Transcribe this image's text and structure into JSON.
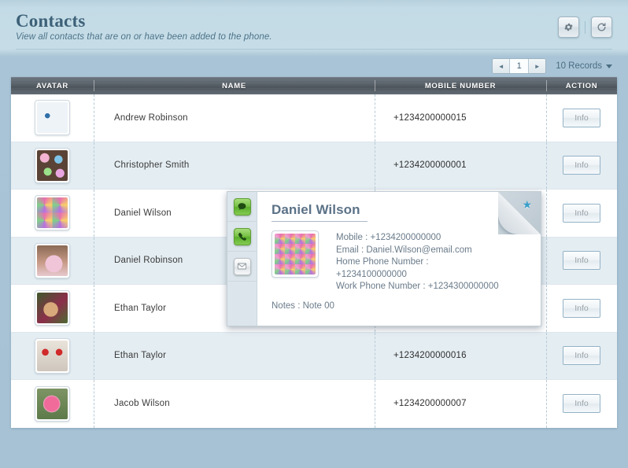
{
  "header": {
    "title": "Contacts",
    "subtitle": "View all contacts that are on or have been added to the phone.",
    "settings_icon": "gear-icon",
    "refresh_icon": "refresh-icon"
  },
  "pager": {
    "prev_label": "◄",
    "page_number": "1",
    "next_label": "►",
    "records_label": "10 Records"
  },
  "table": {
    "columns": [
      "AVATAR",
      "NAME",
      "MOBILE NUMBER",
      "ACTION"
    ],
    "action_label": "Info",
    "rows": [
      {
        "name": "Andrew  Robinson",
        "mobile": "+1234200000015",
        "action": "Info"
      },
      {
        "name": "Christopher  Smith",
        "mobile": "+1234200000001",
        "action": "Info"
      },
      {
        "name": "Daniel  Wilson",
        "mobile": "",
        "action": "Info"
      },
      {
        "name": "Daniel  Robinson",
        "mobile": "",
        "action": "Info"
      },
      {
        "name": "Ethan  Taylor",
        "mobile": "",
        "action": "Info"
      },
      {
        "name": "Ethan  Taylor",
        "mobile": "+1234200000016",
        "action": "Info"
      },
      {
        "name": "Jacob  Wilson",
        "mobile": "+1234200000007",
        "action": "Info"
      }
    ]
  },
  "popup": {
    "title": "Daniel Wilson",
    "rail": [
      "message-icon",
      "phone-icon",
      "mail-icon"
    ],
    "fields": [
      "Mobile :   +1234200000000",
      "Email :   Daniel.Wilson@email.com",
      "Home Phone Number :",
      "+1234100000000",
      "Work Phone Number :   +1234300000000"
    ],
    "notes": "Notes :   Note 00",
    "favorite_icon": "star-icon"
  },
  "colors": {
    "page_background": "#a6c2d4",
    "header_background": "#c3dbe6",
    "title_text": "#3d6178",
    "table_header": "#565e66",
    "row_alt": "#e4edf2",
    "accent_star": "#3b9fc9",
    "action_border": "#93b2c6"
  }
}
